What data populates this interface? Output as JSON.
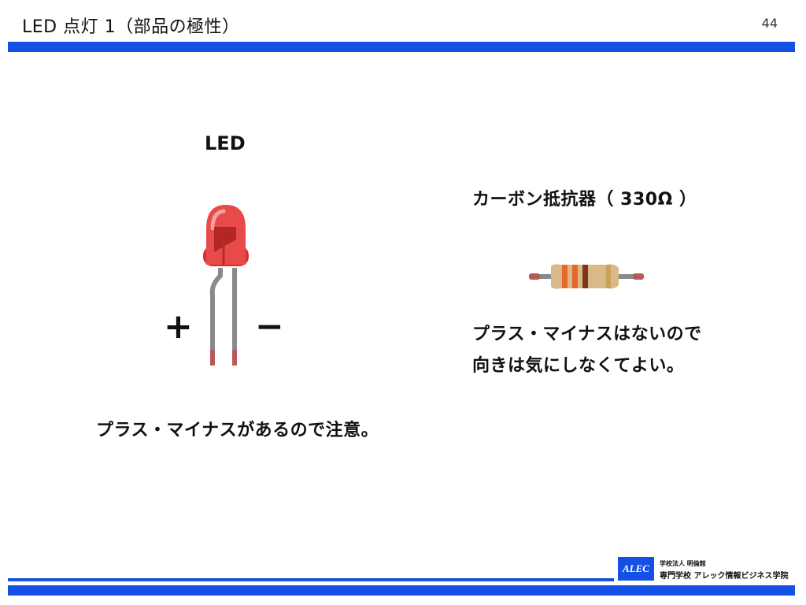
{
  "header": {
    "title": "LED 点灯 1（部品の極性）",
    "page_number": "44"
  },
  "led": {
    "label": "LED",
    "plus_sign": "+",
    "minus_sign": "−",
    "note": "プラス・マイナスがあるので注意。"
  },
  "resistor": {
    "label": "カーボン抵抗器（ 330Ω ）",
    "note_line1": "プラス・マイナスはないので",
    "note_line2": "向きは気にしなくてよい。"
  },
  "footer": {
    "logo_mark": "ALEC",
    "org_line1": "学校法人 明倫館",
    "org_line2": "専門学校 アレック情報ビジネス学院"
  },
  "colors": {
    "accent": "#1450e6",
    "led_red": "#e53a3a",
    "lead_gray": "#8a8a8a"
  }
}
